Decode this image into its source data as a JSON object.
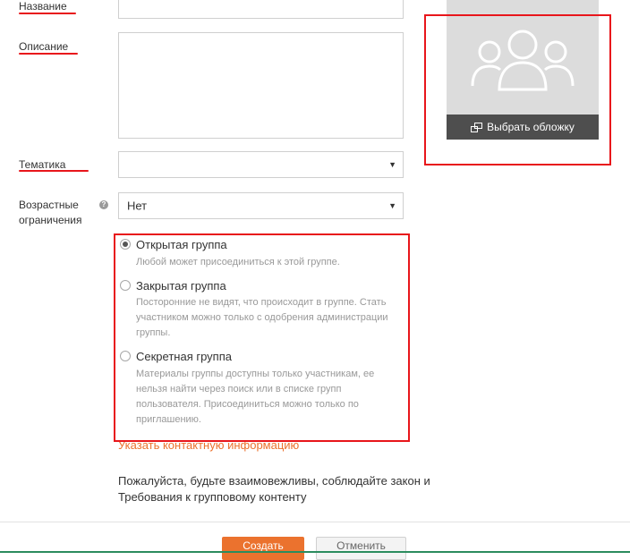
{
  "form": {
    "name_label": "Название",
    "description_label": "Описание",
    "topic_label": "Тематика",
    "topic_value": "",
    "age_label_line1": "Возрастные",
    "age_label_line2": "ограничения",
    "age_value": "Нет"
  },
  "cover": {
    "button_label": "Выбрать обложку"
  },
  "privacy": {
    "options": [
      {
        "title": "Открытая группа",
        "selected": true,
        "desc_lines": [
          "Любой может присоединиться к этой группе."
        ]
      },
      {
        "title": "Закрытая группа",
        "selected": false,
        "desc_lines": [
          "Посторонние не видят, что происходит в группе. Стать",
          "участником можно только с одобрения администрации",
          "группы."
        ]
      },
      {
        "title": "Секретная группа",
        "selected": false,
        "desc_lines": [
          "Материалы группы доступны только участникам, ее",
          "нельзя найти через поиск или в списке групп",
          "пользователя. Присоединиться можно только по",
          "приглашению."
        ]
      }
    ]
  },
  "contact_link": "Указать контактную информацию",
  "notice": {
    "line1": "Пожалуйста, будьте взаимовежливы, соблюдайте закон и",
    "line2": "Требования к групповому контенту"
  },
  "buttons": {
    "create": "Создать",
    "cancel": "Отменить"
  },
  "colors": {
    "accent": "#eb722e",
    "highlight": "#e8161b",
    "cover_bg": "#dcdcdc",
    "cover_button": "#4e4e4e"
  }
}
